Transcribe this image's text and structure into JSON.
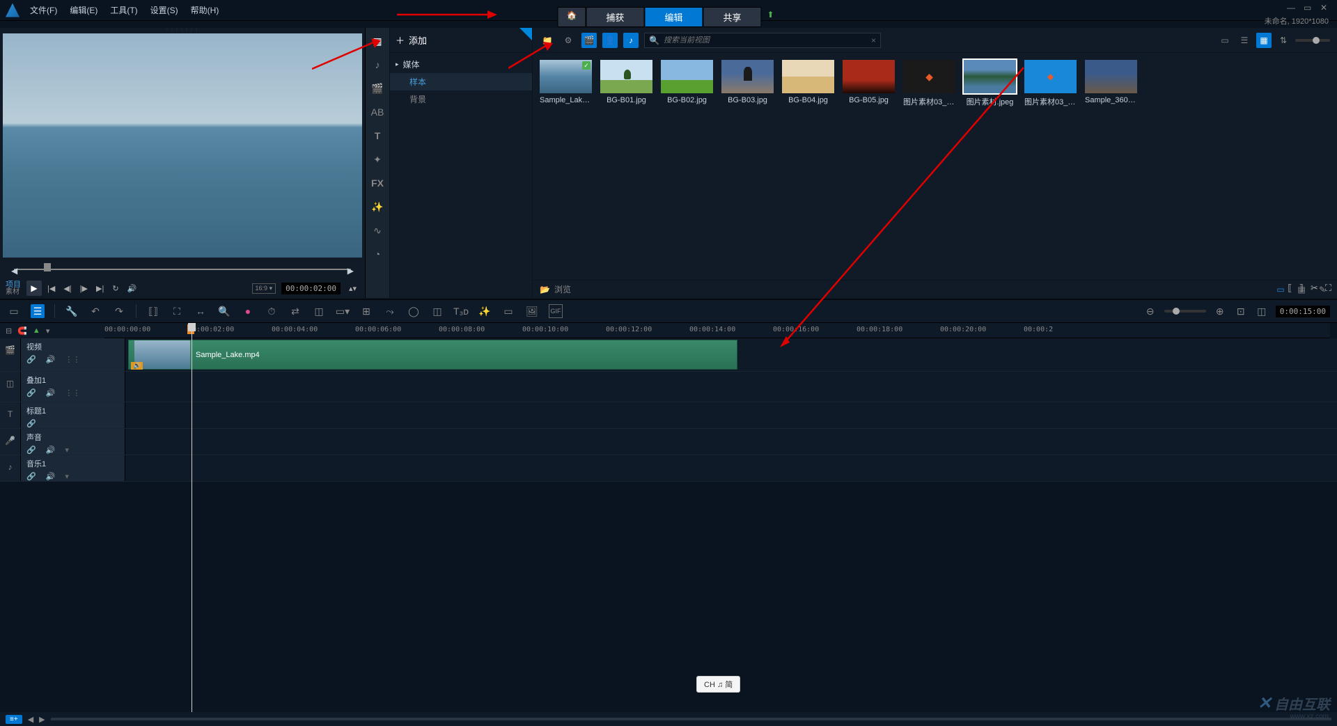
{
  "menubar": {
    "file": "文件(F)",
    "edit": "编辑(E)",
    "tools": "工具(T)",
    "settings": "设置(S)",
    "help": "帮助(H)"
  },
  "main_tabs": {
    "capture": "捕获",
    "edit": "编辑",
    "share": "共享"
  },
  "window_title": "未命名, 1920*1080",
  "preview": {
    "project_label": "项目",
    "project_sub": "素材",
    "timecode": "00:00:02:00",
    "aspect": "16:9"
  },
  "library": {
    "add_label": "添加",
    "tree_media": "媒体",
    "tree_sample": "样本",
    "tree_background": "背景",
    "search_placeholder": "搜索当前视图",
    "browse_label": "浏览",
    "items": [
      {
        "label": "Sample_Lake...",
        "cls": "th-lake",
        "checked": true
      },
      {
        "label": "BG-B01.jpg",
        "cls": "th-tree"
      },
      {
        "label": "BG-B02.jpg",
        "cls": "th-green"
      },
      {
        "label": "BG-B03.jpg",
        "cls": "th-sunset-tree"
      },
      {
        "label": "BG-B04.jpg",
        "cls": "th-desert"
      },
      {
        "label": "BG-B05.jpg",
        "cls": "th-red"
      },
      {
        "label": "图片素材03_副...",
        "cls": "th-black-icon"
      },
      {
        "label": "图片素材.jpeg",
        "cls": "th-mountain",
        "selected": true
      },
      {
        "label": "图片素材03_副...",
        "cls": "th-blue-icon"
      },
      {
        "label": "Sample_360.m...",
        "cls": "th-360"
      }
    ]
  },
  "timeline": {
    "ruler": [
      "00:00:00:00",
      "00:00:02:00",
      "00:00:04:00",
      "00:00:06:00",
      "00:00:08:00",
      "00:00:10:00",
      "00:00:12:00",
      "00:00:14:00",
      "00:00:16:00",
      "00:00:18:00",
      "00:00:20:00",
      "00:00:2"
    ],
    "time_right": "0:00:15:00",
    "clip_name": "Sample_Lake.mp4",
    "tracks": {
      "video": "视频",
      "overlay": "叠加1",
      "title": "标题1",
      "voice": "声音",
      "music": "音乐1"
    }
  },
  "ime": "CH ♫ 简",
  "watermark": {
    "brand": "自由互联",
    "url": "www.xz.com"
  }
}
